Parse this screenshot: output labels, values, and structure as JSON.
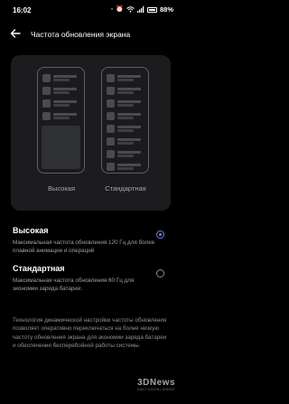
{
  "status_bar": {
    "time": "16:02",
    "battery": "88%",
    "icons": [
      "ring-mode-icon",
      "alarm-icon",
      "wifi-icon",
      "signal-icon",
      "battery-icon"
    ]
  },
  "header": {
    "title": "Частота обновления экрана",
    "back_icon": "arrow-left-icon"
  },
  "preview": {
    "left_label": "Высокая",
    "right_label": "Стандартная"
  },
  "options": [
    {
      "title": "Высокая",
      "description": "Максимальная частота обновления 120 Гц для более плавной анимации и операций",
      "selected": true
    },
    {
      "title": "Стандартная",
      "description": "Максимальная частота обновления 60 Гц для экономии заряда батареи.",
      "selected": false
    }
  ],
  "footnote": "Технология динамической настройки частоты обновления позволяет оперативно переключаться на более низкую частоту обновления экрана для экономии заряда батареи и обеспечения бесперебойной работы системы.",
  "watermark": {
    "main": "3DNews",
    "sub": "DAILY DIGITAL DIGEST"
  },
  "colors": {
    "accent": "#6b7fe8",
    "background": "#000000",
    "card": "#1c1c1e"
  }
}
